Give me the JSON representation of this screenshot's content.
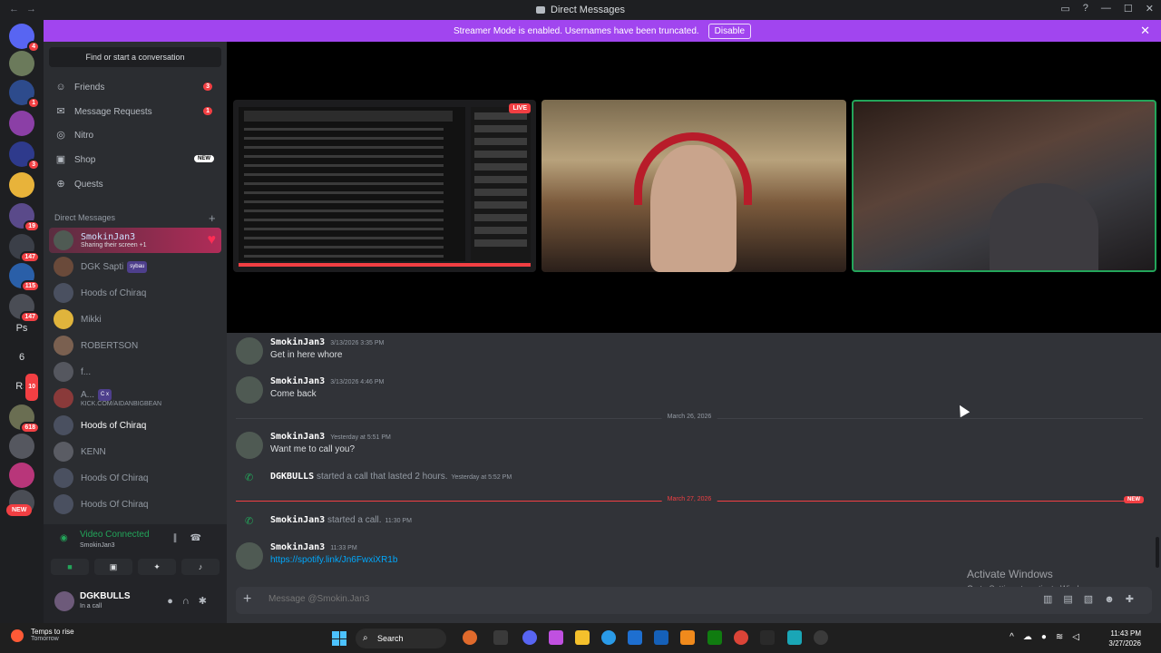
{
  "window": {
    "title": "Direct Messages"
  },
  "streamer_mode": {
    "text": "Streamer Mode is enabled. Usernames have been truncated.",
    "button": "Disable"
  },
  "guilds": {
    "badges": [
      "4",
      "1",
      "3",
      "19",
      "147",
      "115",
      "147",
      "10",
      "618"
    ],
    "letters": [
      "Ps",
      "6",
      "Rs"
    ],
    "new_label": "NEW"
  },
  "dm_pane": {
    "find_placeholder": "Find or start a conversation",
    "nav": [
      {
        "label": "Friends",
        "count": "3",
        "icon": "friends-icon"
      },
      {
        "label": "Message Requests",
        "count": "1",
        "icon": "mail-icon"
      },
      {
        "label": "Nitro",
        "icon": "nitro-icon"
      },
      {
        "label": "Shop",
        "badge": "NEW",
        "icon": "shop-icon"
      },
      {
        "label": "Quests",
        "icon": "quests-icon"
      }
    ],
    "section_label": "Direct Messages",
    "dms": [
      {
        "name": "SmokinJan3",
        "sub": "Sharing their screen +1"
      },
      {
        "name": "DGK Sapti",
        "tag": "sybau"
      },
      {
        "name": "Hoods of Chiraq"
      },
      {
        "name": "Mikki"
      },
      {
        "name": "ROBERTSON"
      },
      {
        "name": "f..."
      },
      {
        "name": "A...",
        "tag": "C x",
        "sub": "KICK.COM/AIDANBIGBEAN"
      },
      {
        "name": "Hoods of Chiraq"
      },
      {
        "name": "KENN"
      },
      {
        "name": "Hoods Of Chiraq"
      },
      {
        "name": "Hoods Of Chiraq"
      }
    ]
  },
  "voice": {
    "status": "Video Connected",
    "channel": "SmokinJan3"
  },
  "user": {
    "name": "DGKBULLS",
    "status": "In a call"
  },
  "call": {
    "live_label": "LIVE"
  },
  "messages": [
    {
      "author": "SmokinJan3",
      "time": "3/13/2026 3:35 PM",
      "text": "Get in here whore"
    },
    {
      "author": "SmokinJan3",
      "time": "3/13/2026 4:46 PM",
      "text": "Come back"
    },
    {
      "author": "SmokinJan3",
      "time": "Yesterday at 5:51 PM",
      "text": "Want me to call you?"
    },
    {
      "author": "SmokinJan3",
      "time": "11:33 PM",
      "text": "https://spotify.link/Jn6FwxiXR1b"
    }
  ],
  "system": [
    {
      "who": "DGKBULLS",
      "text": "started a call that lasted 2 hours.",
      "time": "Yesterday at 5:52 PM"
    },
    {
      "who": "SmokinJan3",
      "text": "started a call.",
      "time": "11:30 PM"
    }
  ],
  "dividers": {
    "d1": "March 26, 2026",
    "d2": "March 27, 2026",
    "new": "NEW"
  },
  "composer": {
    "placeholder": "Message @Smokin.Jan3"
  },
  "activate": {
    "title": "Activate Windows",
    "sub": "Go to Settings to activate Windows."
  },
  "taskbar": {
    "weather_title": "Temps to rise",
    "weather_sub": "Tomorrow",
    "search": "Search",
    "time": "11:43 PM",
    "date": "3/27/2026"
  }
}
